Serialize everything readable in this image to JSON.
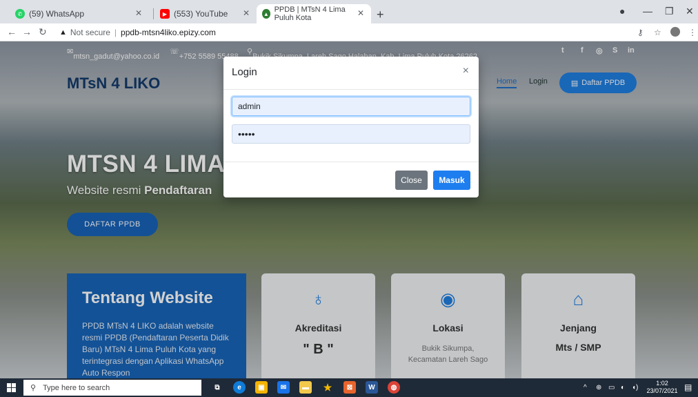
{
  "browser": {
    "tabs": [
      {
        "title": "(59) WhatsApp",
        "color": "#25d366"
      },
      {
        "title": "(553) YouTube",
        "color": "#ff0000"
      },
      {
        "title": "PPDB | MTsN 4 Lima Puluh Kota",
        "color": "#2e7d32"
      }
    ],
    "security_label": "Not secure",
    "url": "ppdb-mtsn4liko.epizy.com"
  },
  "site": {
    "topbar": {
      "email": "mtsn_gadut@yahoo.co.id",
      "phone": "+752 5589 55488",
      "address": "Bukik Sikumpa, Lareh Sago Halaban, Kab. Lima Puluh Kota 26262"
    },
    "brand": "MTsN 4 LIKO",
    "menu": {
      "home": "Home",
      "login": "Login",
      "daftar": "Daftar PPDB"
    },
    "hero": {
      "title": "MTSN 4 LIMA",
      "subtitle_prefix": "Website resmi",
      "subtitle_bold": "Pendaftaran",
      "button": "DAFTAR PPDB"
    },
    "about": {
      "title": "Tentang Website",
      "text": "PPDB MTsN 4 LIKO adalah website resmi PPDB (Pendaftaran Peserta Didik Baru) MTsN 4 Lima Puluh Kota yang terintegrasi dengan Aplikasi WhatsApp Auto Respon"
    },
    "cards": [
      {
        "title": "Akreditasi",
        "value": "\" B \"",
        "icon": "award-icon"
      },
      {
        "title": "Lokasi",
        "value": "Bukik Sikumpa, Kecamatan Lareh Sago",
        "icon": "location-pin-icon"
      },
      {
        "title": "Jenjang",
        "value": "Mts / SMP",
        "icon": "home-icon"
      }
    ]
  },
  "modal": {
    "title": "Login",
    "username_value": "admin",
    "password_value": "•••••",
    "close_label": "Close",
    "submit_label": "Masuk"
  },
  "taskbar": {
    "search_placeholder": "Type here to search",
    "time": "1:02",
    "date": "23/07/2021"
  }
}
